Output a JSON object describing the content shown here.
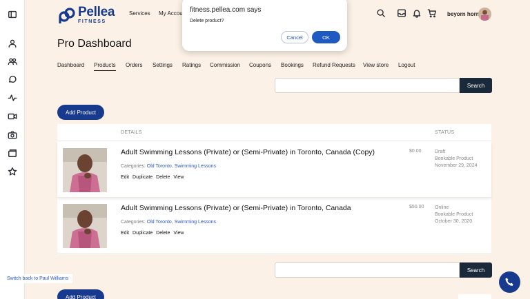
{
  "header": {
    "logo_title": "Pellea",
    "logo_subtitle": "FITNESS",
    "nav": [
      "Services",
      "My Accou"
    ],
    "user_name": "beyorn horn"
  },
  "rail_icons": [
    "sidebar-toggle-icon",
    "user-icon",
    "users-icon",
    "chat-icon",
    "activity-icon",
    "video-icon",
    "camera-icon",
    "folder-icon",
    "star-icon"
  ],
  "page": {
    "title": "Pro Dashboard",
    "tabs": [
      "Dashboard",
      "Products",
      "Orders",
      "Settings",
      "Ratings",
      "Commission",
      "Coupons",
      "Bookings",
      "Refund Requests",
      "View store",
      "Logout"
    ],
    "active_tab": "Products"
  },
  "search": {
    "button_label": "Search",
    "value": ""
  },
  "add_product_label": "Add Product",
  "table": {
    "columns": {
      "details": "DETAILS",
      "status": "STATUS"
    },
    "rows": [
      {
        "title": "Adult Swimming Lessons (Private) or (Semi-Private) in Toronto, Canada (Copy)",
        "categories_label": "Categories:",
        "cat1": "Old Toronto",
        "sep": ",",
        "cat2": "Swimming Lessons",
        "actions": [
          "Edit",
          "Duplicate",
          "Delete",
          "View"
        ],
        "price": "$0.00",
        "status": "Draft",
        "type": "Bookable Product",
        "date": "November 29, 2024"
      },
      {
        "title": "Adult Swimming Lessons (Private) or (Semi-Private) in Toronto, Canada",
        "categories_label": "Categories:",
        "cat1": "Old Toronto",
        "sep": ",",
        "cat2": "Swimming Lessons",
        "actions": [
          "Edit",
          "Duplicate",
          "Delete",
          "View"
        ],
        "price": "$50.00",
        "status": "Online",
        "type": "Bookable Product",
        "date": "October 30, 2020"
      }
    ]
  },
  "switch_back": "Switch back to Paul Williams",
  "dialog": {
    "title": "fitness.pellea.com says",
    "message": "Delete product?",
    "cancel": "Cancel",
    "ok": "OK"
  },
  "colors": {
    "brand": "#173a8f",
    "background": "#fbf1e6",
    "search_button": "#1b2a3a",
    "link": "#2b56c3"
  }
}
